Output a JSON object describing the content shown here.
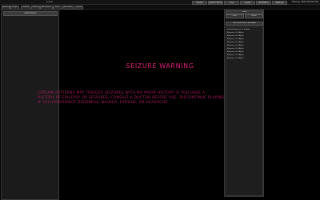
{
  "topbar": {
    "title": "Input",
    "status": "FPS/Lag: 60/60 FPS/60 FPS",
    "buttons": [
      "Strobe",
      "Switch Mode",
      "Log",
      "Labels",
      "Net Patrol",
      "Settings"
    ]
  },
  "toolbar": {
    "buttons": [
      "Animation",
      "Scripts",
      "Controls",
      "Vehicles",
      "Alt Controls",
      "Stats",
      "Host Items",
      "Layout"
    ]
  },
  "left_panel": {
    "header": "Interactions"
  },
  "warning": {
    "title": "SEIZURE WARNING",
    "lines": [
      "Certain patterns may trigger seizures with no prior history. If you have a",
      "history of epilepsy or seizures, consult a doctor before use. Discontinue playing",
      "if you experience dizziness, nausea, fatigue, or headache."
    ]
  },
  "right_panel": {
    "buttons": [
      "Load",
      "Save",
      "Delete",
      "Filter Saved Saves Box Alpha"
    ],
    "items": [
      "Default Blueprint v1.0 Alpha",
      "Blueprint v2.0 Alpha",
      "Blueprint v2.0 Alpha",
      "Blueprint v2.0 Alpha",
      "Blueprint v2.0 Alpha",
      "Blueprint v2.0 Alpha",
      "Blueprint v2.0 Alpha",
      "Blueprint v2.0 Alpha",
      "Blueprint v2.0 Alpha",
      "Blueprint v2.0 Alpha"
    ]
  },
  "colors": {
    "warning_title": "#e0237a",
    "warning_body": "#b0185e",
    "background": "#000000"
  }
}
